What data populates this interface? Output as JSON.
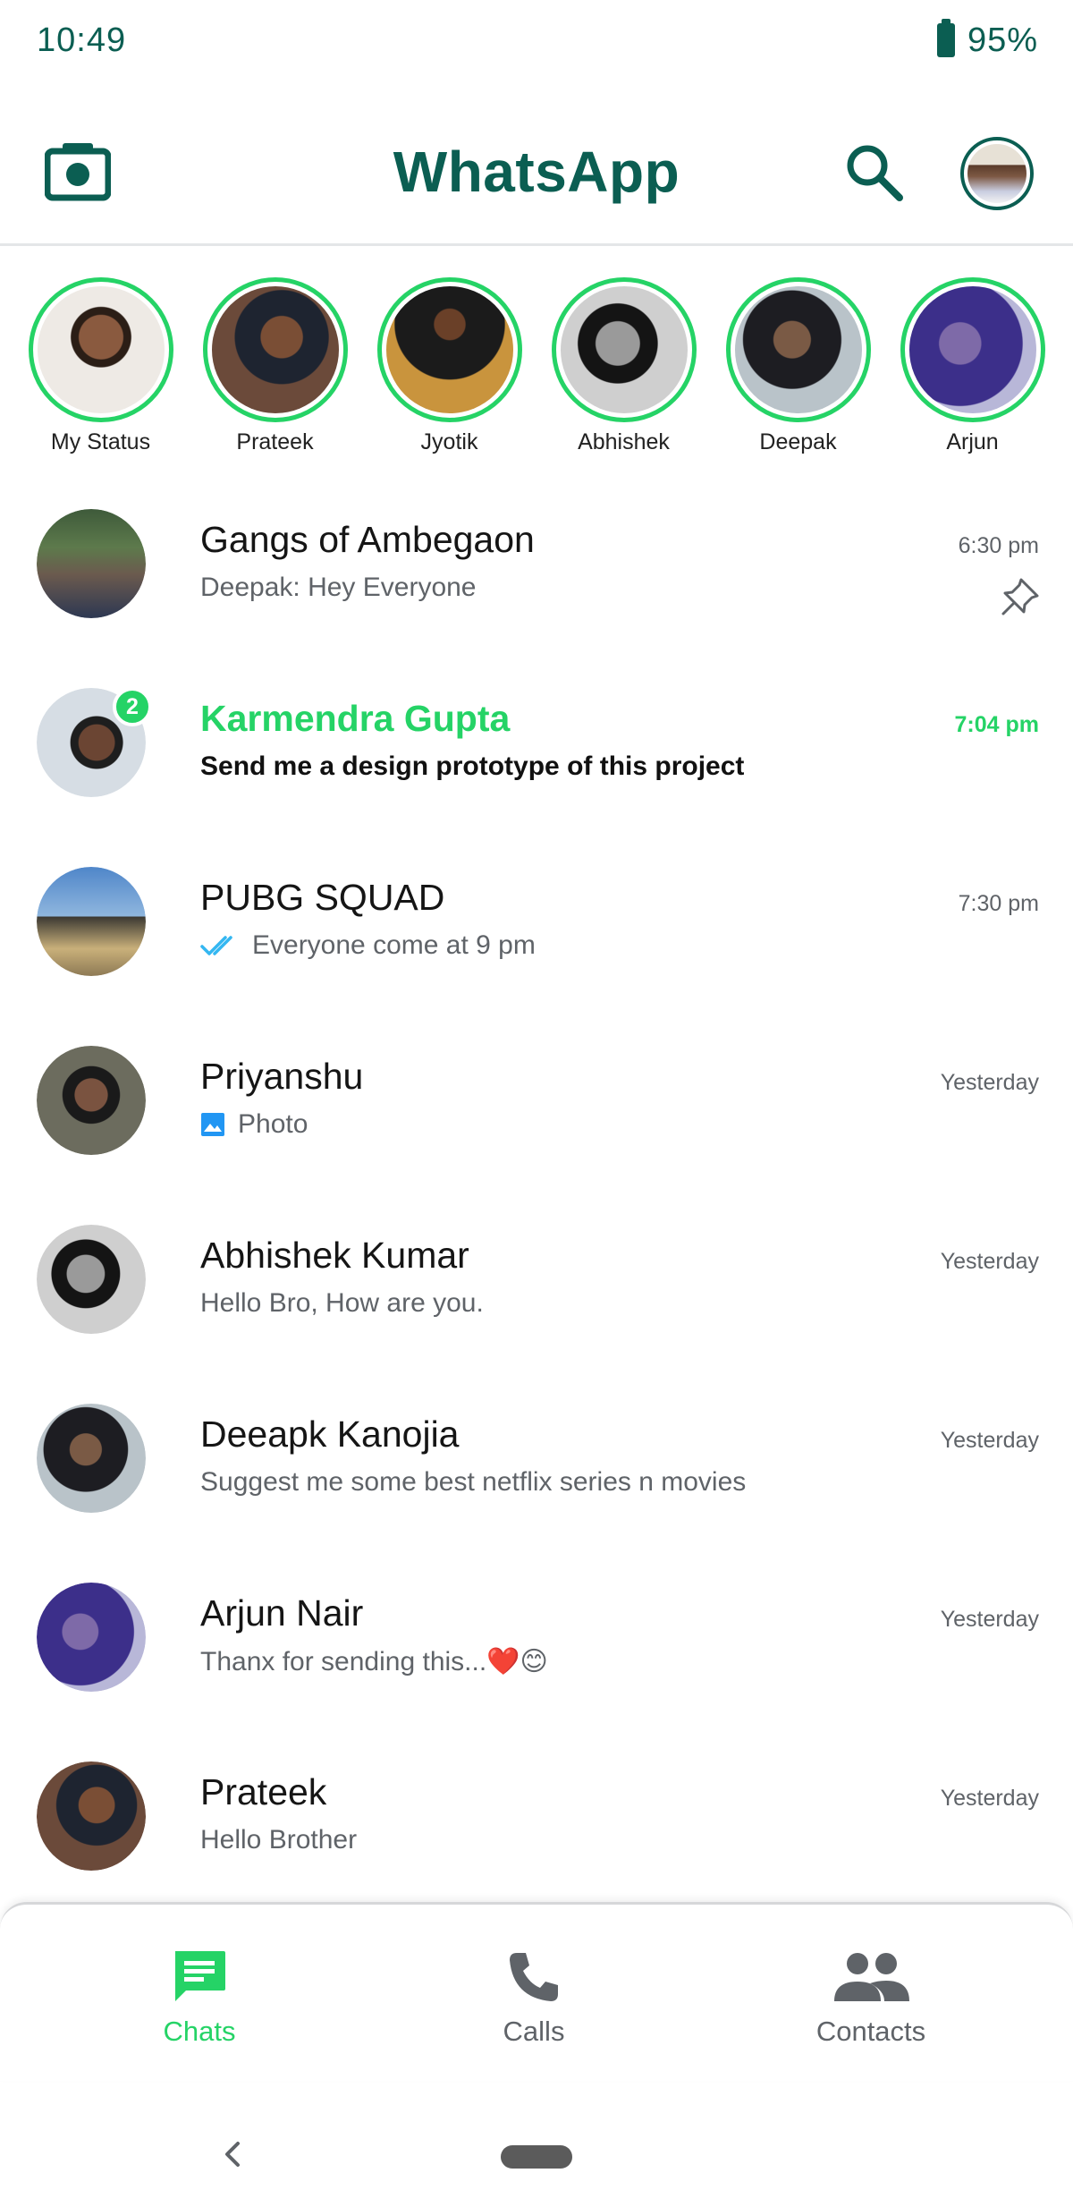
{
  "status_bar": {
    "time": "10:49",
    "battery": "95%"
  },
  "header": {
    "title": "WhatsApp",
    "camera_icon": "camera-icon",
    "search_icon": "search-icon"
  },
  "colors": {
    "primary": "#0b5e52",
    "accent": "#25d366",
    "muted": "#5f6368",
    "read_tick": "#34b7f1"
  },
  "statuses": [
    {
      "name": "My Status"
    },
    {
      "name": "Prateek"
    },
    {
      "name": "Jyotik"
    },
    {
      "name": "Abhishek"
    },
    {
      "name": "Deepak"
    },
    {
      "name": "Arjun"
    }
  ],
  "chats": [
    {
      "name": "Gangs of Ambegaon",
      "message": "Deepak: Hey Everyone",
      "time": "6:30 pm",
      "pinned": true
    },
    {
      "name": "Karmendra Gupta",
      "message": "Send me a design prototype of this project",
      "time": "7:04 pm",
      "unread_count": "2"
    },
    {
      "name": "PUBG SQUAD",
      "message": "Everyone come at 9 pm",
      "time": "7:30 pm",
      "icon": "double-tick-icon"
    },
    {
      "name": "Priyanshu",
      "message": "Photo",
      "time": "Yesterday",
      "icon": "photo-icon"
    },
    {
      "name": "Abhishek Kumar",
      "message": "Hello Bro, How are you.",
      "time": "Yesterday"
    },
    {
      "name": "Deeapk Kanojia",
      "message": "Suggest me some best netflix series n movies",
      "time": "Yesterday"
    },
    {
      "name": "Arjun Nair",
      "message": "Thanx for sending this...❤️😊",
      "time": "Yesterday"
    },
    {
      "name": "Prateek",
      "message": "Hello Brother",
      "time": "Yesterday"
    }
  ],
  "bottom_nav": [
    {
      "label": "Chats",
      "icon": "chat-icon",
      "active": true
    },
    {
      "label": "Calls",
      "icon": "phone-icon"
    },
    {
      "label": "Contacts",
      "icon": "contacts-icon"
    }
  ]
}
